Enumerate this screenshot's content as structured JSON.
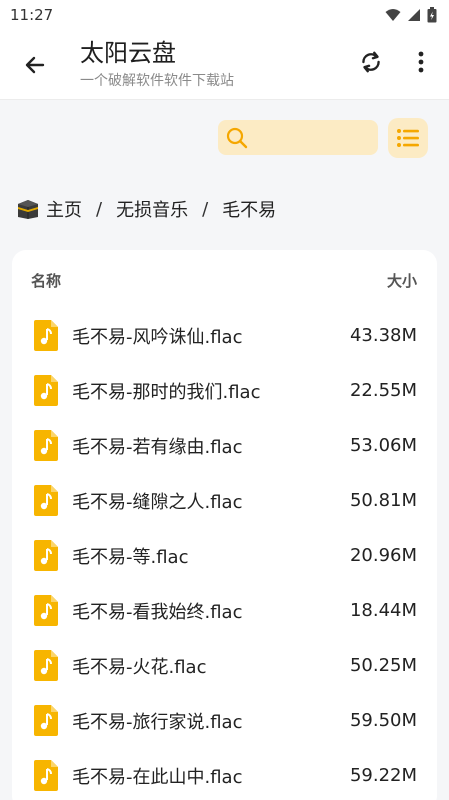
{
  "status_bar": {
    "time": "11:27"
  },
  "app_bar": {
    "title": "太阳云盘",
    "subtitle": "一个破解软件软件下载站"
  },
  "search": {
    "placeholder": ""
  },
  "breadcrumb": [
    "主页",
    "无损音乐",
    "毛不易"
  ],
  "breadcrumb_separator": "/",
  "table": {
    "name_header": "名称",
    "size_header": "大小",
    "rows": [
      {
        "name": "毛不易-风吟诛仙.flac",
        "size": "43.38M"
      },
      {
        "name": "毛不易-那时的我们.flac",
        "size": "22.55M"
      },
      {
        "name": "毛不易-若有缘由.flac",
        "size": "53.06M"
      },
      {
        "name": "毛不易-缝隙之人.flac",
        "size": "50.81M"
      },
      {
        "name": "毛不易-等.flac",
        "size": "20.96M"
      },
      {
        "name": "毛不易-看我始终.flac",
        "size": "18.44M"
      },
      {
        "name": "毛不易-火花.flac",
        "size": "50.25M"
      },
      {
        "name": "毛不易-旅行家说.flac",
        "size": "59.50M"
      },
      {
        "name": "毛不易-在此山中.flac",
        "size": "59.22M"
      }
    ]
  },
  "colors": {
    "accent": "#f5b800",
    "accent_soft": "#fcebc4",
    "music_file_icon": "#f7b500"
  },
  "icons": {
    "back": "arrow-left-icon",
    "refresh": "refresh-icon",
    "more": "more-vertical-icon",
    "search": "search-icon",
    "list": "list-view-icon",
    "home": "kaaba-icon",
    "file": "music-file-icon"
  }
}
